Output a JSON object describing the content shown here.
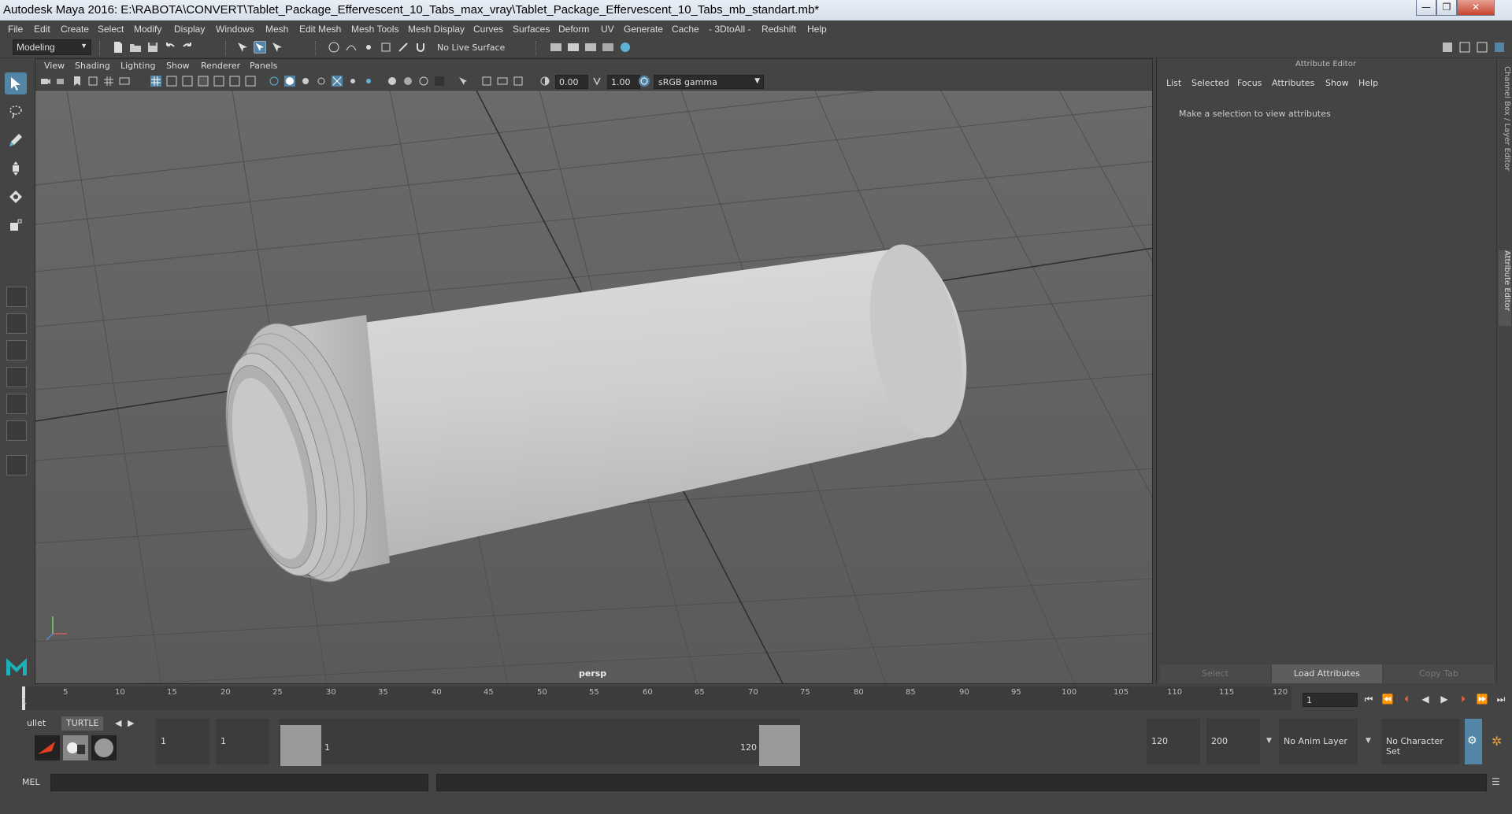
{
  "window": {
    "title": "Autodesk Maya 2016: E:\\RABOTA\\CONVERT\\Tablet_Package_Effervescent_10_Tabs_max_vray\\Tablet_Package_Effervescent_10_Tabs_mb_standart.mb*",
    "minimize": "—",
    "maximize": "❐",
    "close": "✕"
  },
  "menubar": {
    "items": [
      "File",
      "Edit",
      "Create",
      "Select",
      "Modify",
      "Display",
      "Windows",
      "Mesh",
      "Edit Mesh",
      "Mesh Tools",
      "Mesh Display",
      "Curves",
      "Surfaces",
      "Deform",
      "UV",
      "Generate",
      "Cache",
      "- 3DtoAll -",
      "Redshift",
      "Help"
    ]
  },
  "statusbar": {
    "mode": "Modeling",
    "live_surface": "No Live Surface"
  },
  "viewport": {
    "menu": [
      "View",
      "Shading",
      "Lighting",
      "Show",
      "Renderer",
      "Panels"
    ],
    "exposure": "0.00",
    "gamma": "1.00",
    "color_space": "sRGB gamma",
    "camera": "persp"
  },
  "attribute_editor": {
    "header": "Attribute Editor",
    "menu": [
      "List",
      "Selected",
      "Focus",
      "Attributes",
      "Show",
      "Help"
    ],
    "hint": "Make a selection to view attributes",
    "buttons": {
      "select": "Select",
      "load": "Load Attributes",
      "copy": "Copy Tab"
    },
    "side_tabs": {
      "channel_box": "Channel Box / Layer Editor",
      "attribute_editor": "Attribute Editor"
    }
  },
  "timeslider": {
    "ticks": [
      "1",
      "5",
      "10",
      "15",
      "20",
      "25",
      "30",
      "35",
      "40",
      "45",
      "50",
      "55",
      "60",
      "65",
      "70",
      "75",
      "80",
      "85",
      "90",
      "95",
      "100",
      "105",
      "110",
      "115",
      "120"
    ],
    "current_frame": "1"
  },
  "range": {
    "shelf_tabs": [
      "ullet",
      "TURTLE"
    ],
    "start": "1",
    "inner_start": "1",
    "range_start_label": "1",
    "range_end_label": "120",
    "end": "120",
    "outer_end": "200",
    "anim_layer": "No Anim Layer",
    "character_set": "No Character Set"
  },
  "cmdline": {
    "label": "MEL"
  },
  "colors": {
    "accent": "#5285a6",
    "background": "#444444",
    "viewport": "#3e3e3e"
  }
}
